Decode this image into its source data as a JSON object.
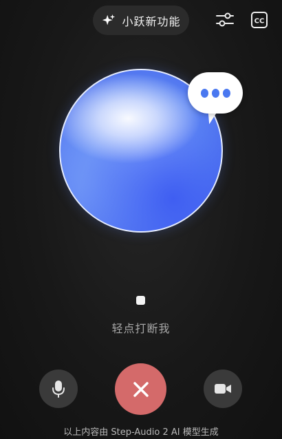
{
  "header": {
    "feature_label": "小跃新功能",
    "feature_icon": "sparkle-icon",
    "settings_icon": "sliders-icon",
    "captions_icon": "cc-icon",
    "captions_label": "CC"
  },
  "orb": {
    "status_bubble_icon": "typing-dots-icon"
  },
  "status": {
    "hint": "轻点打断我"
  },
  "controls": {
    "mic_icon": "microphone-icon",
    "end_icon": "close-icon",
    "video_icon": "video-camera-icon",
    "end_color": "#d46a6a"
  },
  "footer": {
    "disclaimer": "以上内容由 Step-Audio 2 AI 模型生成"
  }
}
